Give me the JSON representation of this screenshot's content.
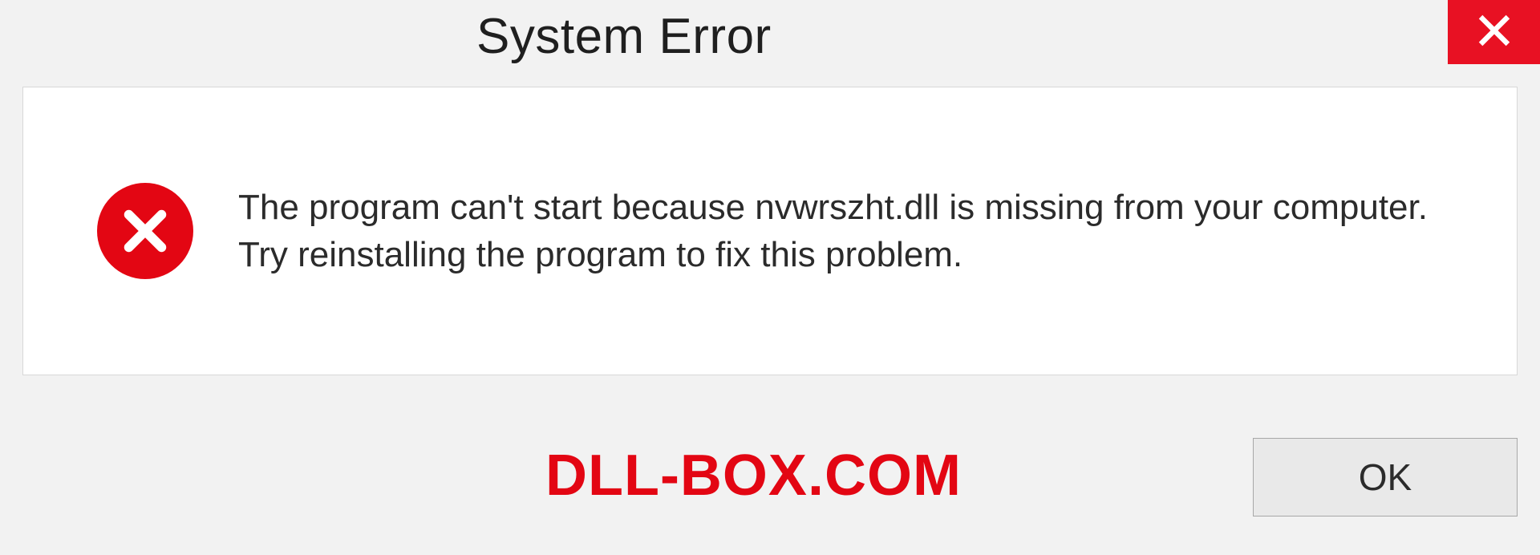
{
  "titlebar": {
    "title": "System Error"
  },
  "dialog": {
    "message": "The program can't start because nvwrszht.dll is missing from your computer. Try reinstalling the program to fix this problem."
  },
  "footer": {
    "watermark": "DLL-BOX.COM",
    "ok_label": "OK"
  },
  "colors": {
    "error_red": "#e30613",
    "close_red": "#e81123",
    "panel_bg": "#ffffff",
    "window_bg": "#f2f2f2"
  }
}
